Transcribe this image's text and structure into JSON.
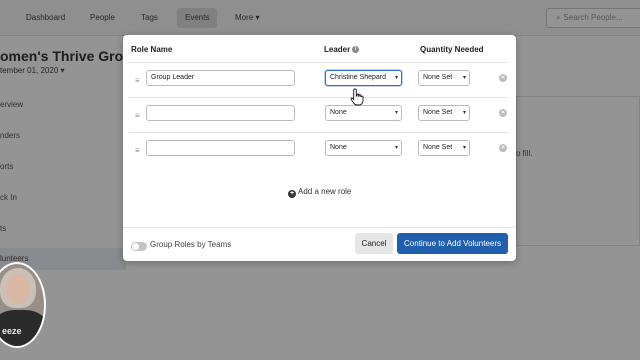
{
  "nav": {
    "items": [
      "Dashboard",
      "People",
      "Tags",
      "Events",
      "More"
    ],
    "search_placeholder": "Search People..."
  },
  "group": {
    "title": "omen's Thrive Grou",
    "date": "tember 01, 2020"
  },
  "sidebar": {
    "items": [
      "erview",
      "nders",
      "orts",
      "ck In",
      "ts",
      "lunteers"
    ]
  },
  "background_panel": {
    "text": "o fill."
  },
  "webcam": {
    "shirt_text": "eeze"
  },
  "modal": {
    "headers": {
      "role_name": "Role Name",
      "leader": "Leader",
      "quantity": "Quantity Needed"
    },
    "rows": [
      {
        "role": "Group Leader",
        "leader": "Christine Shepard",
        "quantity": "None Set"
      },
      {
        "role": "",
        "leader": "None",
        "quantity": "None Set"
      },
      {
        "role": "",
        "leader": "None",
        "quantity": "None Set"
      }
    ],
    "add_role_label": "Add a new role",
    "toggle_label": "Group Roles by Teams",
    "cancel_label": "Cancel",
    "continue_label": "Continue to Add Volunteers"
  },
  "colors": {
    "primary_button": "#1f5fae",
    "focus_outline": "#2a6fc4"
  }
}
